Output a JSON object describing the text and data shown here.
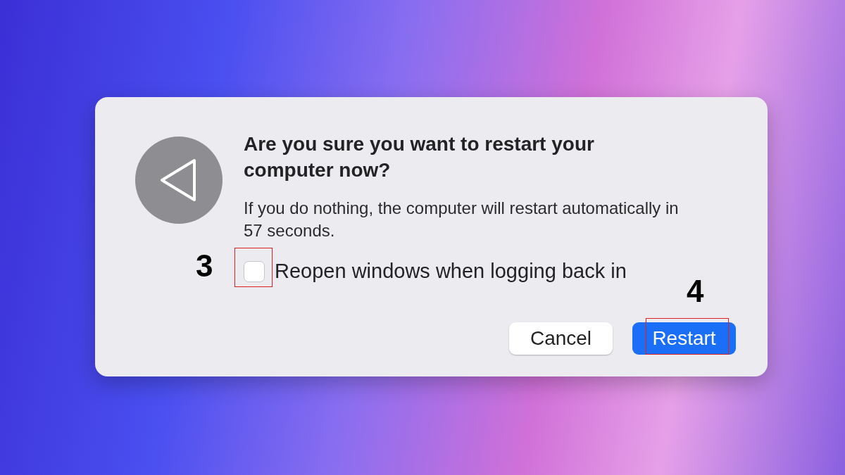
{
  "dialog": {
    "title": "Are you sure you want to restart your computer now?",
    "message": "If you do nothing, the computer will restart automatically in 57 seconds.",
    "checkbox": {
      "label": "Reopen windows when logging back in",
      "checked": false
    },
    "buttons": [
      {
        "label": "Cancel",
        "kind": "secondary"
      },
      {
        "label": "Restart",
        "kind": "default"
      }
    ]
  },
  "annotations": [
    {
      "label": "3",
      "kind": "checkbox"
    },
    {
      "label": "4",
      "kind": "button"
    }
  ]
}
